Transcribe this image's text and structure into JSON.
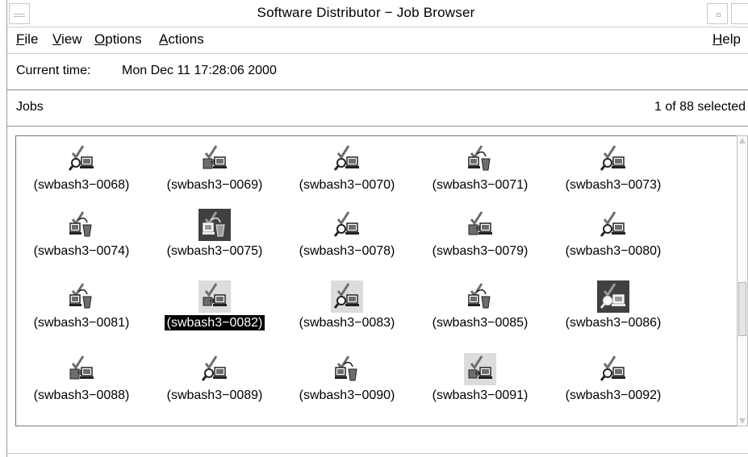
{
  "window": {
    "title": "Software Distributor − Job Browser"
  },
  "menubar": {
    "file": {
      "pre": "",
      "key": "F",
      "post": "ile"
    },
    "view": {
      "pre": "",
      "key": "V",
      "post": "iew"
    },
    "options": {
      "pre": "",
      "key": "O",
      "post": "ptions"
    },
    "actions": {
      "pre": "",
      "key": "A",
      "post": "ctions"
    },
    "help": {
      "pre": "",
      "key": "H",
      "post": "elp"
    }
  },
  "status": {
    "current_time_label": "Current time:",
    "current_time_value": "Mon Dec 11 17:28:06 2000"
  },
  "jobs": {
    "label": "Jobs",
    "selection_count": "1 of 88 selected",
    "items": [
      {
        "label": "(swbash3−0068)",
        "icon": "analysis-job-icon"
      },
      {
        "label": "(swbash3−0069)",
        "icon": "copy-job-icon"
      },
      {
        "label": "(swbash3−0070)",
        "icon": "analysis-job-icon"
      },
      {
        "label": "(swbash3−0071)",
        "icon": "remove-job-icon"
      },
      {
        "label": "(swbash3−0073)",
        "icon": "analysis-job-icon"
      },
      {
        "label": "(swbash3−0074)",
        "icon": "remove-job-icon"
      },
      {
        "label": "(swbash3−0075)",
        "icon": "remove-job-icon"
      },
      {
        "label": "(swbash3−0078)",
        "icon": "analysis-job-icon"
      },
      {
        "label": "(swbash3−0079)",
        "icon": "copy-job-icon"
      },
      {
        "label": "(swbash3−0080)",
        "icon": "analysis-job-icon"
      },
      {
        "label": "(swbash3−0081)",
        "icon": "remove-job-icon"
      },
      {
        "label": "(swbash3−0082)",
        "icon": "install-job-icon",
        "selected": true
      },
      {
        "label": "(swbash3−0083)",
        "icon": "analysis-job-icon"
      },
      {
        "label": "(swbash3−0085)",
        "icon": "remove-job-icon"
      },
      {
        "label": "(swbash3−0086)",
        "icon": "analysis-job-icon"
      },
      {
        "label": "(swbash3−0088)",
        "icon": "copy-job-icon"
      },
      {
        "label": "(swbash3−0089)",
        "icon": "analysis-job-icon"
      },
      {
        "label": "(swbash3−0090)",
        "icon": "remove-job-icon"
      },
      {
        "label": "(swbash3−0091)",
        "icon": "install-job-icon"
      },
      {
        "label": "(swbash3−0092)",
        "icon": "analysis-job-icon"
      }
    ]
  }
}
